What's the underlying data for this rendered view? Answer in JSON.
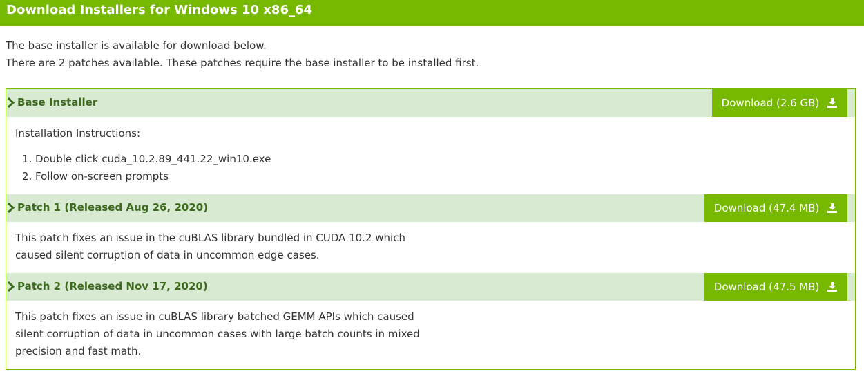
{
  "header": {
    "title": "Download Installers for Windows 10 x86_64"
  },
  "intro": {
    "line1": "The base installer is available for download below.",
    "line2": "There are 2 patches available. These patches require the base installer to be installed first."
  },
  "base": {
    "title": "Base Installer",
    "download": "Download (2.6 GB)",
    "instructions_label": "Installation Instructions:",
    "steps": [
      "Double click cuda_10.2.89_441.22_win10.exe",
      "Follow on-screen prompts"
    ]
  },
  "patch1": {
    "title": "Patch 1 (Released Aug 26, 2020)",
    "download": "Download (47.4 MB)",
    "desc": [
      "This patch fixes an issue in the cuBLAS library bundled in CUDA 10.2 which",
      "caused silent corruption of data in uncommon edge cases."
    ]
  },
  "patch2": {
    "title": "Patch 2 (Released Nov 17, 2020)",
    "download": "Download (47.5 MB)",
    "desc": [
      "This patch fixes an issue in cuBLAS library batched GEMM APIs which caused",
      "silent corruption of data in uncommon cases with large batch counts in mixed",
      "precision and fast math."
    ]
  },
  "icons": {
    "expand": "chevron-right-icon",
    "download": "download-icon"
  },
  "colors": {
    "accent": "#76b900",
    "row_bg": "#d9ead3",
    "title_text": "#3d6b1e"
  }
}
